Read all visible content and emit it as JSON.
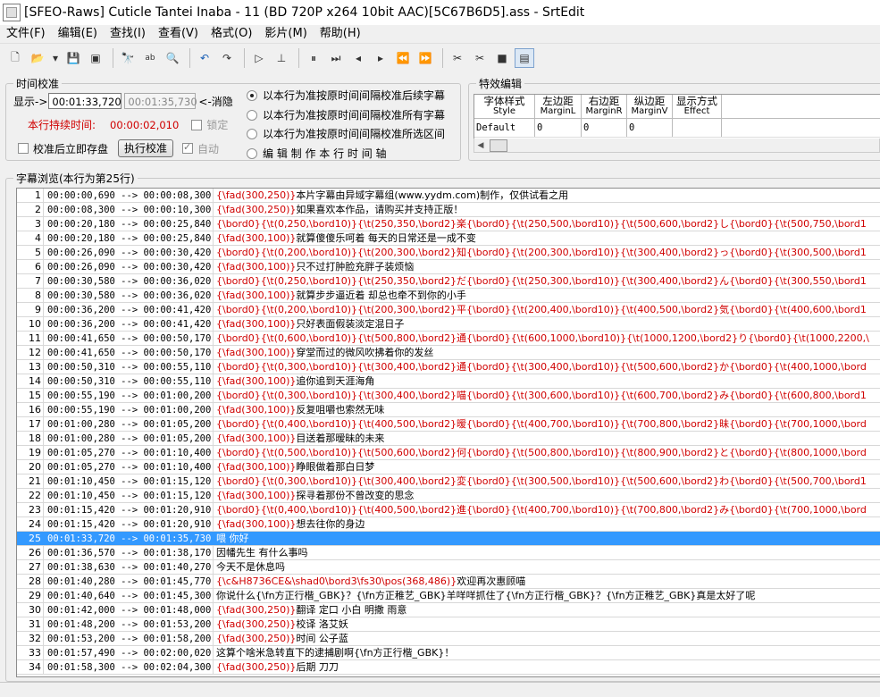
{
  "window": {
    "title": "[SFEO-Raws] Cuticle Tantei Inaba - 11 (BD 720P x264 10bit AAC)[5C67B6D5].ass - SrtEdit"
  },
  "menu": [
    "文件(F)",
    "编辑(E)",
    "查找(I)",
    "查看(V)",
    "格式(O)",
    "影片(M)",
    "帮助(H)"
  ],
  "toolbar_icons": [
    "new-icon",
    "open-icon",
    "dropdown-icon",
    "save-icon",
    "save-all-icon",
    "find-icon",
    "replace-icon",
    "search-preview-icon",
    "undo-icon",
    "redo-icon",
    "play-icon",
    "step-icon",
    "pause-icon",
    "step-forward-icon",
    "prev-icon",
    "next-icon",
    "rewind-icon",
    "fast-forward-icon",
    "cut-start-icon",
    "cut-end-icon",
    "film-icon",
    "panel-icon"
  ],
  "timing": {
    "group_label": "时间校准",
    "display_label": "显示->",
    "start_time": "00:01:33,720",
    "end_time": "00:01:35,730",
    "arrow_label": "<-消隐",
    "duration_label": "本行持续时间:",
    "duration_value": "00:00:02,010",
    "lock_label": "锁定",
    "autosave_label": "校准后立即存盘",
    "calibrate_button": "执行校准",
    "auto_label": "自动",
    "options": [
      "以本行为准按原时间间隔校准后续字幕",
      "以本行为准按原时间间隔校准所有字幕",
      "以本行为准按原时间间隔校准所选区间",
      "编 辑 制 作 本 行 时 间 轴"
    ],
    "selected_option": 0
  },
  "effects": {
    "group_label": "特效编辑",
    "columns": [
      {
        "cn": "字体样式",
        "en": "Style"
      },
      {
        "cn": "左边距",
        "en": "MarginL"
      },
      {
        "cn": "右边距",
        "en": "MarginR"
      },
      {
        "cn": "纵边距",
        "en": "MarginV"
      },
      {
        "cn": "显示方式",
        "en": "Effect"
      }
    ],
    "row": [
      "Default",
      "0",
      "0",
      "0",
      ""
    ]
  },
  "browse": {
    "group_label": "字幕浏览(本行为第25行)",
    "selected_row": 25,
    "rows": [
      {
        "n": "1",
        "t": "00:00:00,690 --> 00:00:08,300",
        "c": "{\\fad(300,250)}",
        "x": "本片字幕由异域字幕组(www.yydm.com)制作，仅供试看之用"
      },
      {
        "n": "2",
        "t": "00:00:08,300 --> 00:00:10,300",
        "c": "{\\fad(300,250)}",
        "x": "如果喜欢本作品，请购买并支持正版！"
      },
      {
        "n": "3",
        "t": "00:00:20,180 --> 00:00:25,840",
        "c": "{\\bord0}{\\t(0,250,\\bord10)}{\\t(250,350,\\bord2}楽{\\bord0}{\\t(250,500,\\bord10)}{\\t(500,600,\\bord2}し{\\bord0}{\\t(500,750,\\bord1",
        "x": ""
      },
      {
        "n": "4",
        "t": "00:00:20,180 --> 00:00:25,840",
        "c": "{\\fad(300,100)}",
        "x": "就算傻傻乐呵着 每天的日常还是一成不变"
      },
      {
        "n": "5",
        "t": "00:00:26,090 --> 00:00:30,420",
        "c": "{\\bord0}{\\t(0,200,\\bord10)}{\\t(200,300,\\bord2}知{\\bord0}{\\t(200,300,\\bord10)}{\\t(300,400,\\bord2}っ{\\bord0}{\\t(300,500,\\bord1",
        "x": ""
      },
      {
        "n": "6",
        "t": "00:00:26,090 --> 00:00:30,420",
        "c": "{\\fad(300,100)}",
        "x": "只不过打肿脸充胖子装烦恼"
      },
      {
        "n": "7",
        "t": "00:00:30,580 --> 00:00:36,020",
        "c": "{\\bord0}{\\t(0,250,\\bord10)}{\\t(250,350,\\bord2}だ{\\bord0}{\\t(250,300,\\bord10)}{\\t(300,400,\\bord2}ん{\\bord0}{\\t(300,550,\\bord1",
        "x": ""
      },
      {
        "n": "8",
        "t": "00:00:30,580 --> 00:00:36,020",
        "c": "{\\fad(300,100)}",
        "x": "就算步步逼近着 却总也牵不到你的小手"
      },
      {
        "n": "9",
        "t": "00:00:36,200 --> 00:00:41,420",
        "c": "{\\bord0}{\\t(0,200,\\bord10)}{\\t(200,300,\\bord2}平{\\bord0}{\\t(200,400,\\bord10)}{\\t(400,500,\\bord2}気{\\bord0}{\\t(400,600,\\bord1",
        "x": ""
      },
      {
        "n": "10",
        "t": "00:00:36,200 --> 00:00:41,420",
        "c": "{\\fad(300,100)}",
        "x": "只好表面假装淡定混日子"
      },
      {
        "n": "11",
        "t": "00:00:41,650 --> 00:00:50,170",
        "c": "{\\bord0}{\\t(0,600,\\bord10)}{\\t(500,800,\\bord2}通{\\bord0}{\\t(600,1000,\\bord10)}{\\t(1000,1200,\\bord2}り{\\bord0}{\\t(1000,2200,\\",
        "x": ""
      },
      {
        "n": "12",
        "t": "00:00:41,650 --> 00:00:50,170",
        "c": "{\\fad(300,100)}",
        "x": "穿堂而过的微风吹拂着你的发丝"
      },
      {
        "n": "13",
        "t": "00:00:50,310 --> 00:00:55,110",
        "c": "{\\bord0}{\\t(0,300,\\bord10)}{\\t(300,400,\\bord2}通{\\bord0}{\\t(300,400,\\bord10)}{\\t(500,600,\\bord2}か{\\bord0}{\\t(400,1000,\\bord",
        "x": ""
      },
      {
        "n": "14",
        "t": "00:00:50,310 --> 00:00:55,110",
        "c": "{\\fad(300,100)}",
        "x": "追你追到天涯海角"
      },
      {
        "n": "15",
        "t": "00:00:55,190 --> 00:01:00,200",
        "c": "{\\bord0}{\\t(0,300,\\bord10)}{\\t(300,400,\\bord2}喵{\\bord0}{\\t(300,600,\\bord10)}{\\t(600,700,\\bord2}み{\\bord0}{\\t(600,800,\\bord1",
        "x": ""
      },
      {
        "n": "16",
        "t": "00:00:55,190 --> 00:01:00,200",
        "c": "{\\fad(300,100)}",
        "x": "反复咀嚼也索然无味"
      },
      {
        "n": "17",
        "t": "00:01:00,280 --> 00:01:05,200",
        "c": "{\\bord0}{\\t(0,400,\\bord10)}{\\t(400,500,\\bord2}暧{\\bord0}{\\t(400,700,\\bord10)}{\\t(700,800,\\bord2}昧{\\bord0}{\\t(700,1000,\\bord",
        "x": ""
      },
      {
        "n": "18",
        "t": "00:01:00,280 --> 00:01:05,200",
        "c": "{\\fad(300,100)}",
        "x": "目送着那暧昧的未来"
      },
      {
        "n": "19",
        "t": "00:01:05,270 --> 00:01:10,400",
        "c": "{\\bord0}{\\t(0,500,\\bord10)}{\\t(500,600,\\bord2}何{\\bord0}{\\t(500,800,\\bord10)}{\\t(800,900,\\bord2}と{\\bord0}{\\t(800,1000,\\bord",
        "x": ""
      },
      {
        "n": "20",
        "t": "00:01:05,270 --> 00:01:10,400",
        "c": "{\\fad(300,100)}",
        "x": "睁眼做着那白日梦"
      },
      {
        "n": "21",
        "t": "00:01:10,450 --> 00:01:15,120",
        "c": "{\\bord0}{\\t(0,300,\\bord10)}{\\t(300,400,\\bord2}変{\\bord0}{\\t(300,500,\\bord10)}{\\t(500,600,\\bord2}わ{\\bord0}{\\t(500,700,\\bord1",
        "x": ""
      },
      {
        "n": "22",
        "t": "00:01:10,450 --> 00:01:15,120",
        "c": "{\\fad(300,100)}",
        "x": "探寻着那份不曾改变的思念"
      },
      {
        "n": "23",
        "t": "00:01:15,420 --> 00:01:20,910",
        "c": "{\\bord0}{\\t(0,400,\\bord10)}{\\t(400,500,\\bord2}進{\\bord0}{\\t(400,700,\\bord10)}{\\t(700,800,\\bord2}み{\\bord0}{\\t(700,1000,\\bord",
        "x": ""
      },
      {
        "n": "24",
        "t": "00:01:15,420 --> 00:01:20,910",
        "c": "{\\fad(300,100)}",
        "x": "想去往你的身边"
      },
      {
        "n": "25",
        "t": "00:01:33,720 --> 00:01:35,730",
        "c": "",
        "x": "喂 你好"
      },
      {
        "n": "26",
        "t": "00:01:36,570 --> 00:01:38,170",
        "c": "",
        "x": "因幡先生 有什么事吗"
      },
      {
        "n": "27",
        "t": "00:01:38,630 --> 00:01:40,270",
        "c": "",
        "x": "今天不是休息吗"
      },
      {
        "n": "28",
        "t": "00:01:40,280 --> 00:01:45,770",
        "c": "{\\c&H8736CE&\\shad0\\bord3\\fs30\\pos(368,486)}",
        "x": "欢迎再次惠顾喵"
      },
      {
        "n": "29",
        "t": "00:01:40,640 --> 00:01:45,300",
        "c": "",
        "x": "你说什么{\\fn方正行楷_GBK}？{\\fn方正稚艺_GBK}羊咩咩抓住了{\\fn方正行楷_GBK}？{\\fn方正稚艺_GBK}真是太好了呢"
      },
      {
        "n": "30",
        "t": "00:01:42,000 --> 00:01:48,000",
        "c": "{\\fad(300,250)}",
        "x": "翻译     定口     小白     明撒     雨意"
      },
      {
        "n": "31",
        "t": "00:01:48,200 --> 00:01:53,200",
        "c": "{\\fad(300,250)}",
        "x": "校译     洛艾妖"
      },
      {
        "n": "32",
        "t": "00:01:53,200 --> 00:01:58,200",
        "c": "{\\fad(300,250)}",
        "x": "时间     公子蓝"
      },
      {
        "n": "33",
        "t": "00:01:57,490 --> 00:02:00,020",
        "c": "",
        "x": "这算个啥米急转直下的逮捕剧啊{\\fn方正行楷_GBK}！"
      },
      {
        "n": "34",
        "t": "00:01:58,300 --> 00:02:04,300",
        "c": "{\\fad(300,250)}",
        "x": "后期     刀刀"
      }
    ]
  }
}
